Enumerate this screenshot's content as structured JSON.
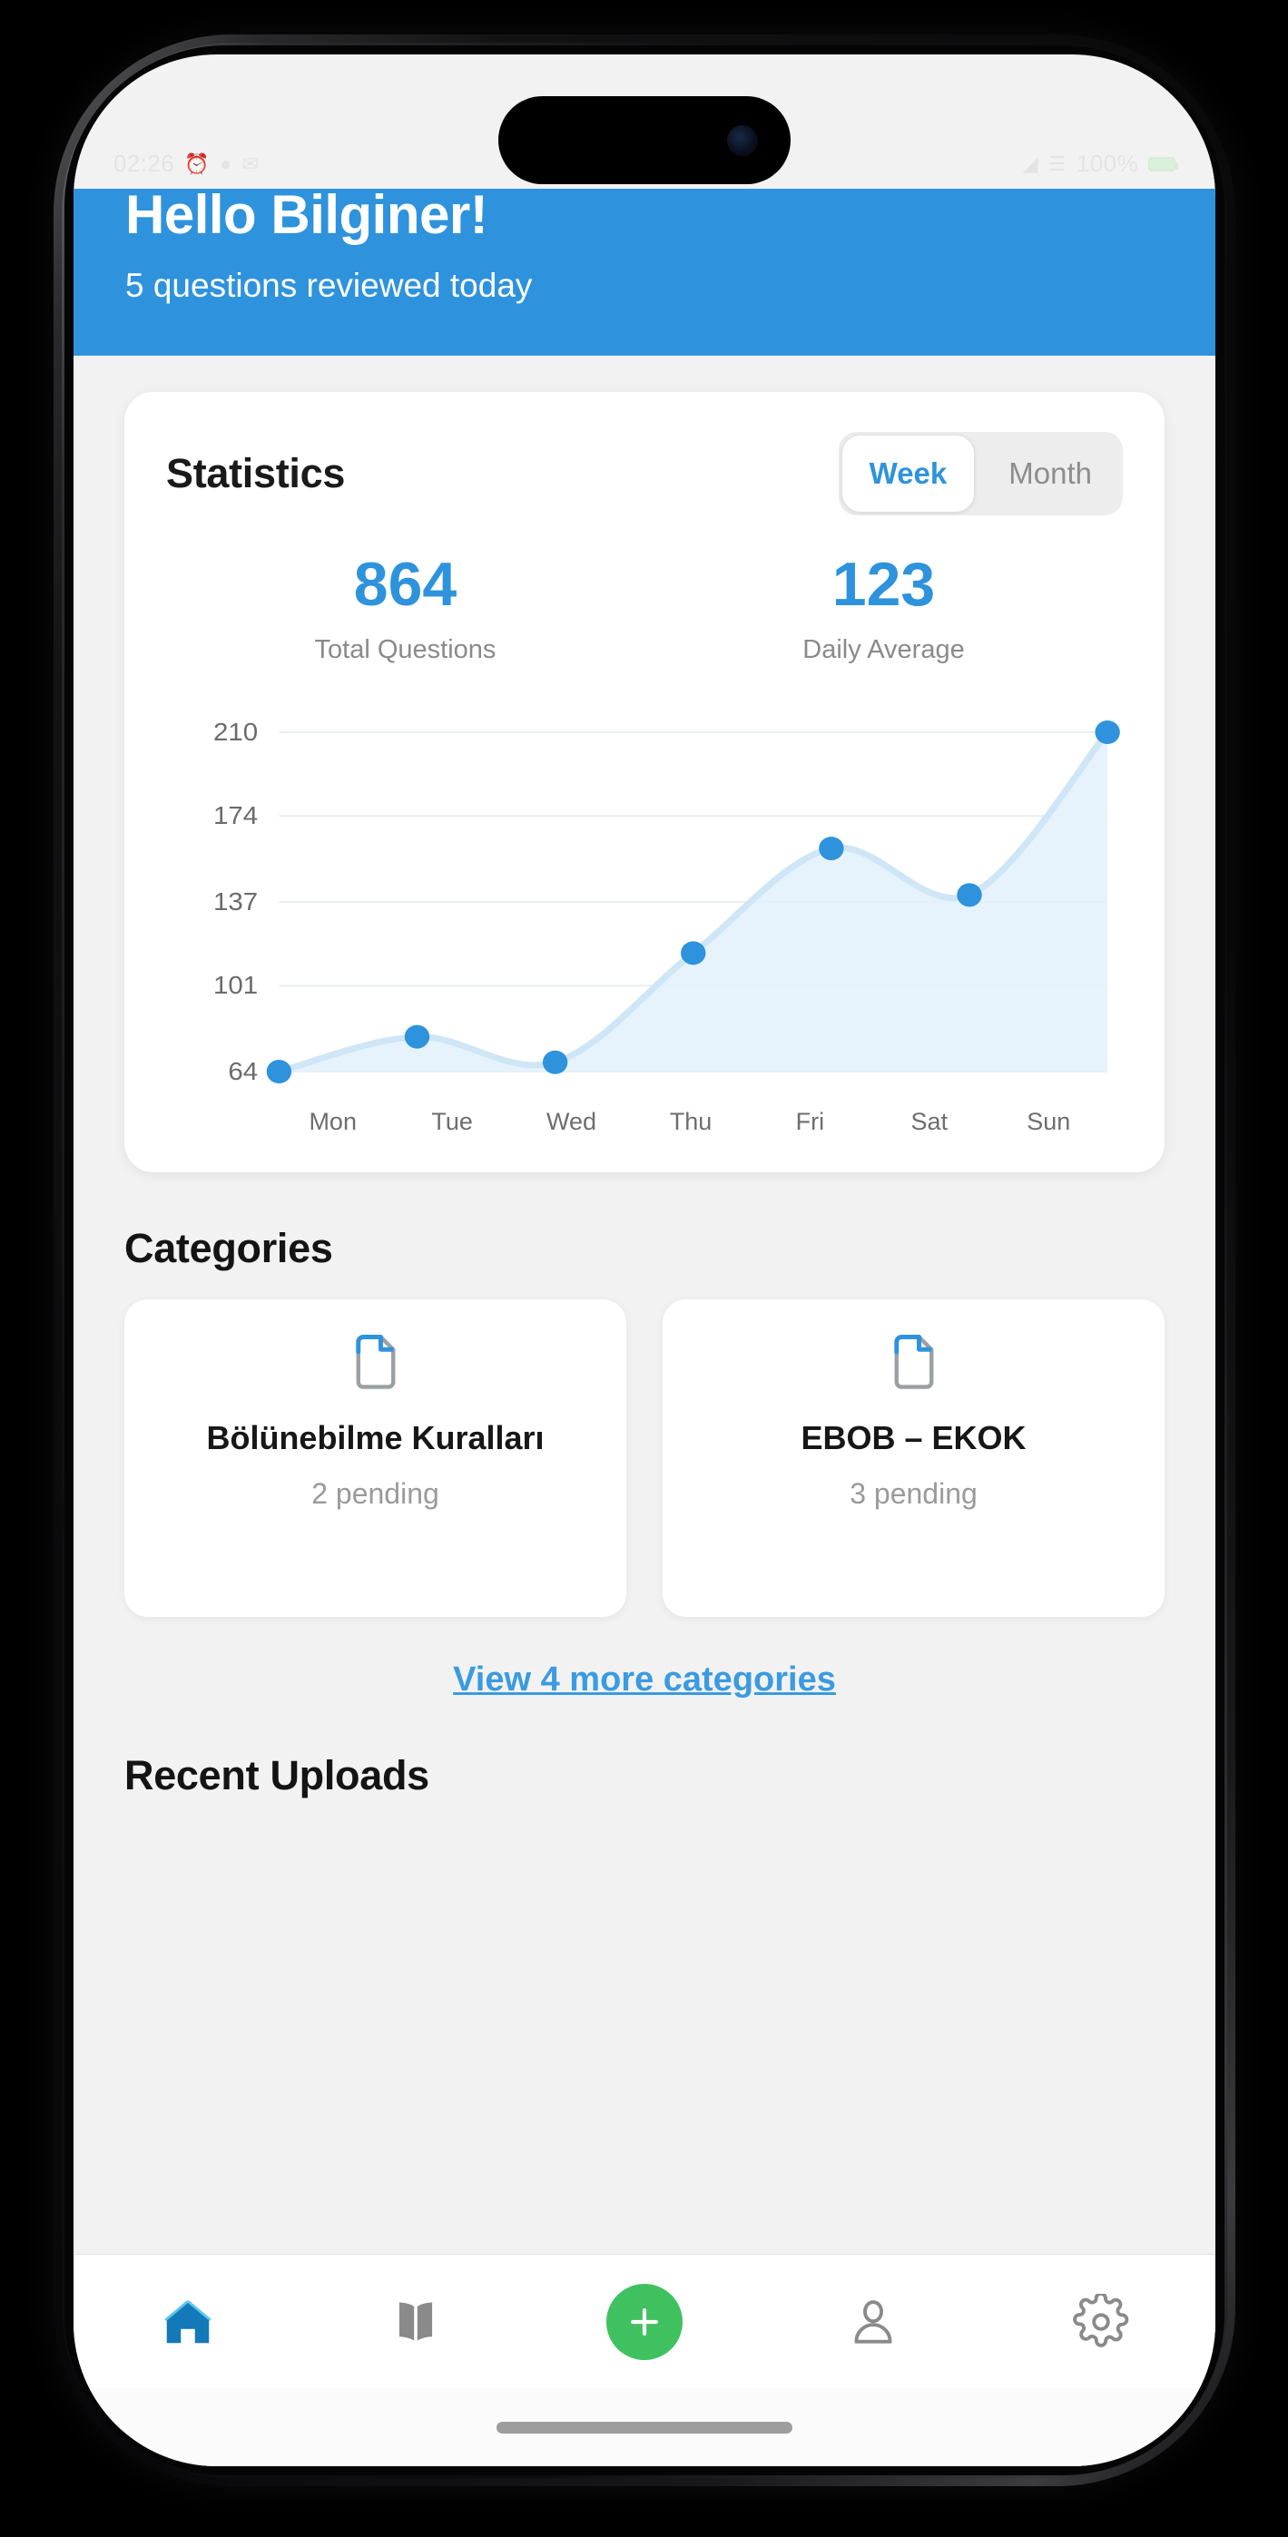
{
  "status_bar": {
    "time": "02:26",
    "battery_text": "100%",
    "icons": [
      "alarm-icon",
      "wifi-icon",
      "signal-icon",
      "battery-icon"
    ]
  },
  "hero": {
    "greeting": "Hello Bilginer!",
    "subtitle": "5 questions reviewed today",
    "background_color": "#2e93dc"
  },
  "statistics": {
    "title": "Statistics",
    "range_options": [
      {
        "label": "Week",
        "active": true
      },
      {
        "label": "Month",
        "active": false
      }
    ],
    "metrics": [
      {
        "value": "864",
        "label": "Total Questions"
      },
      {
        "value": "123",
        "label": "Daily Average"
      }
    ],
    "accent_color": "#2e93dc"
  },
  "chart_data": {
    "type": "area",
    "title": "",
    "xlabel": "",
    "ylabel": "",
    "categories": [
      "Mon",
      "Tue",
      "Wed",
      "Thu",
      "Fri",
      "Sat",
      "Sun"
    ],
    "values": [
      64,
      79,
      68,
      115,
      160,
      140,
      210
    ],
    "yticks": [
      64,
      101,
      137,
      174,
      210
    ],
    "ylim": [
      64,
      210
    ],
    "grid": true,
    "legend": "none",
    "line_color": "#cfe6f7",
    "point_color": "#2e93dc",
    "fill_color": "#e3f1fb"
  },
  "categories_section": {
    "title": "Categories",
    "cards": [
      {
        "icon": "document-icon",
        "name": "Bölünebilme Kuralları",
        "pending": "2 pending"
      },
      {
        "icon": "document-icon",
        "name": "EBOB – EKOK",
        "pending": "3 pending"
      }
    ],
    "view_more_label": "View 4 more categories"
  },
  "recent_uploads": {
    "title": "Recent Uploads"
  },
  "tabbar": {
    "items": [
      {
        "name": "home-icon",
        "label": "Home",
        "active": true
      },
      {
        "name": "book-icon",
        "label": "Library",
        "active": false
      },
      {
        "name": "plus-icon",
        "label": "Add",
        "active": false,
        "color": "#3fc15f"
      },
      {
        "name": "person-icon",
        "label": "Profile",
        "active": false
      },
      {
        "name": "gear-icon",
        "label": "Settings",
        "active": false
      }
    ],
    "active_color": "#1379b8",
    "inactive_color": "#8a8a8a"
  }
}
